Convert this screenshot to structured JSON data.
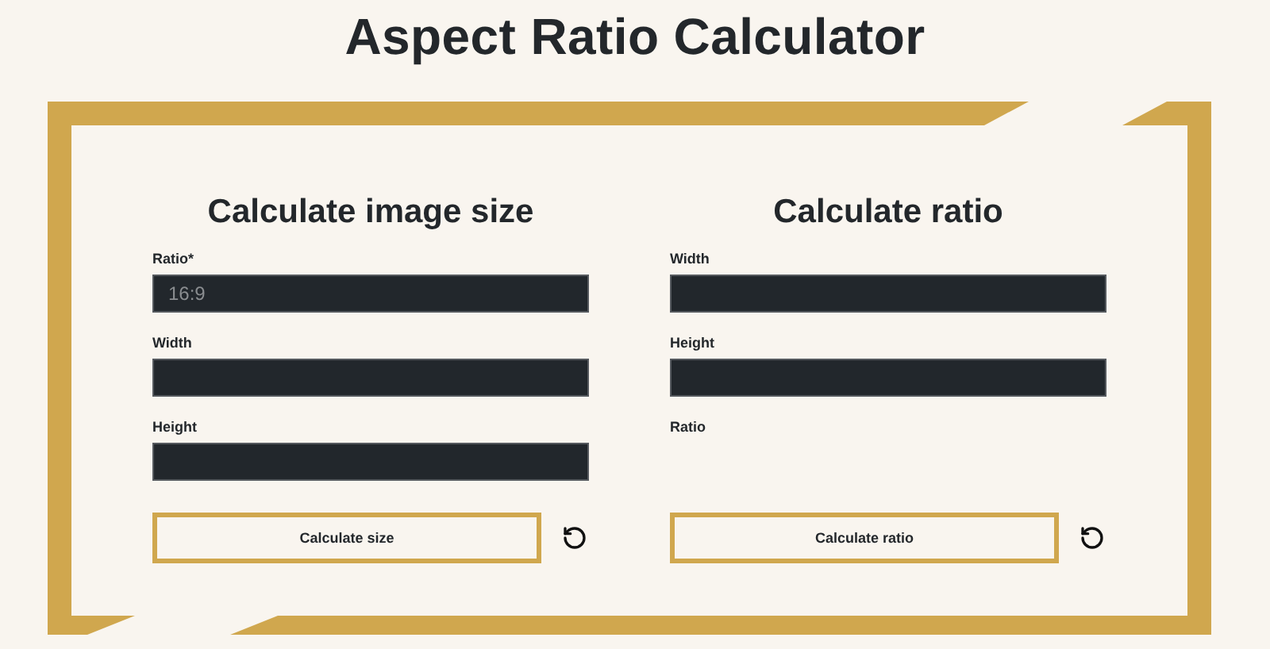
{
  "title": "Aspect Ratio Calculator",
  "panels": [
    {
      "heading": "Calculate image size",
      "fields": [
        {
          "label": "Ratio*",
          "kind": "input",
          "placeholder": "16:9"
        },
        {
          "label": "Width",
          "kind": "input"
        },
        {
          "label": "Height",
          "kind": "input"
        }
      ],
      "button": "Calculate size"
    },
    {
      "heading": "Calculate ratio",
      "fields": [
        {
          "label": "Width",
          "kind": "input"
        },
        {
          "label": "Height",
          "kind": "input"
        },
        {
          "label": "Ratio",
          "kind": "result"
        }
      ],
      "button": "Calculate ratio"
    }
  ]
}
